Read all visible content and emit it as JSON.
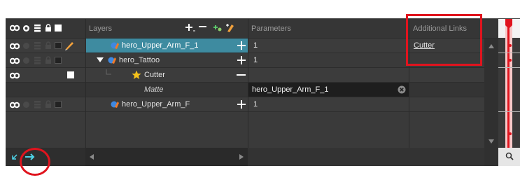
{
  "header": {
    "layers_label": "Layers",
    "parameters_label": "Parameters",
    "additional_links_label": "Additional Links"
  },
  "rows": [
    {
      "name": "hero_Upper_Arm_F_1",
      "param": "1",
      "link": "Cutter",
      "selected": true
    },
    {
      "name": "hero_Tattoo",
      "param": "1"
    },
    {
      "name": "Cutter",
      "param": ""
    },
    {
      "matte_label": "Matte",
      "matte_value": "hero_Upper_Arm_F_1"
    },
    {
      "name": "hero_Upper_Arm_F",
      "param": "1"
    }
  ],
  "colors": {
    "panel_bg": "#3a3a3a",
    "selected_row": "#3e8ba0",
    "teal": "#4ed4e8",
    "highlight_red": "#e0141e",
    "link": "#4ed4e8"
  },
  "icons": [
    "eye-icon",
    "solo-icon",
    "layers-icon",
    "lock-icon",
    "color-swatch-icon",
    "pencil-icon",
    "drawing-layer-icon",
    "star-cutter-icon",
    "add-layer-icon",
    "delete-layer-icon",
    "add-peg-icon",
    "add-drawing-icon",
    "add-icon",
    "remove-icon",
    "clear-icon",
    "scroll-up-icon",
    "scroll-down-icon",
    "scroll-left-icon",
    "scroll-right-icon",
    "collapse-arrow-icon",
    "expand-arrow-icon"
  ]
}
